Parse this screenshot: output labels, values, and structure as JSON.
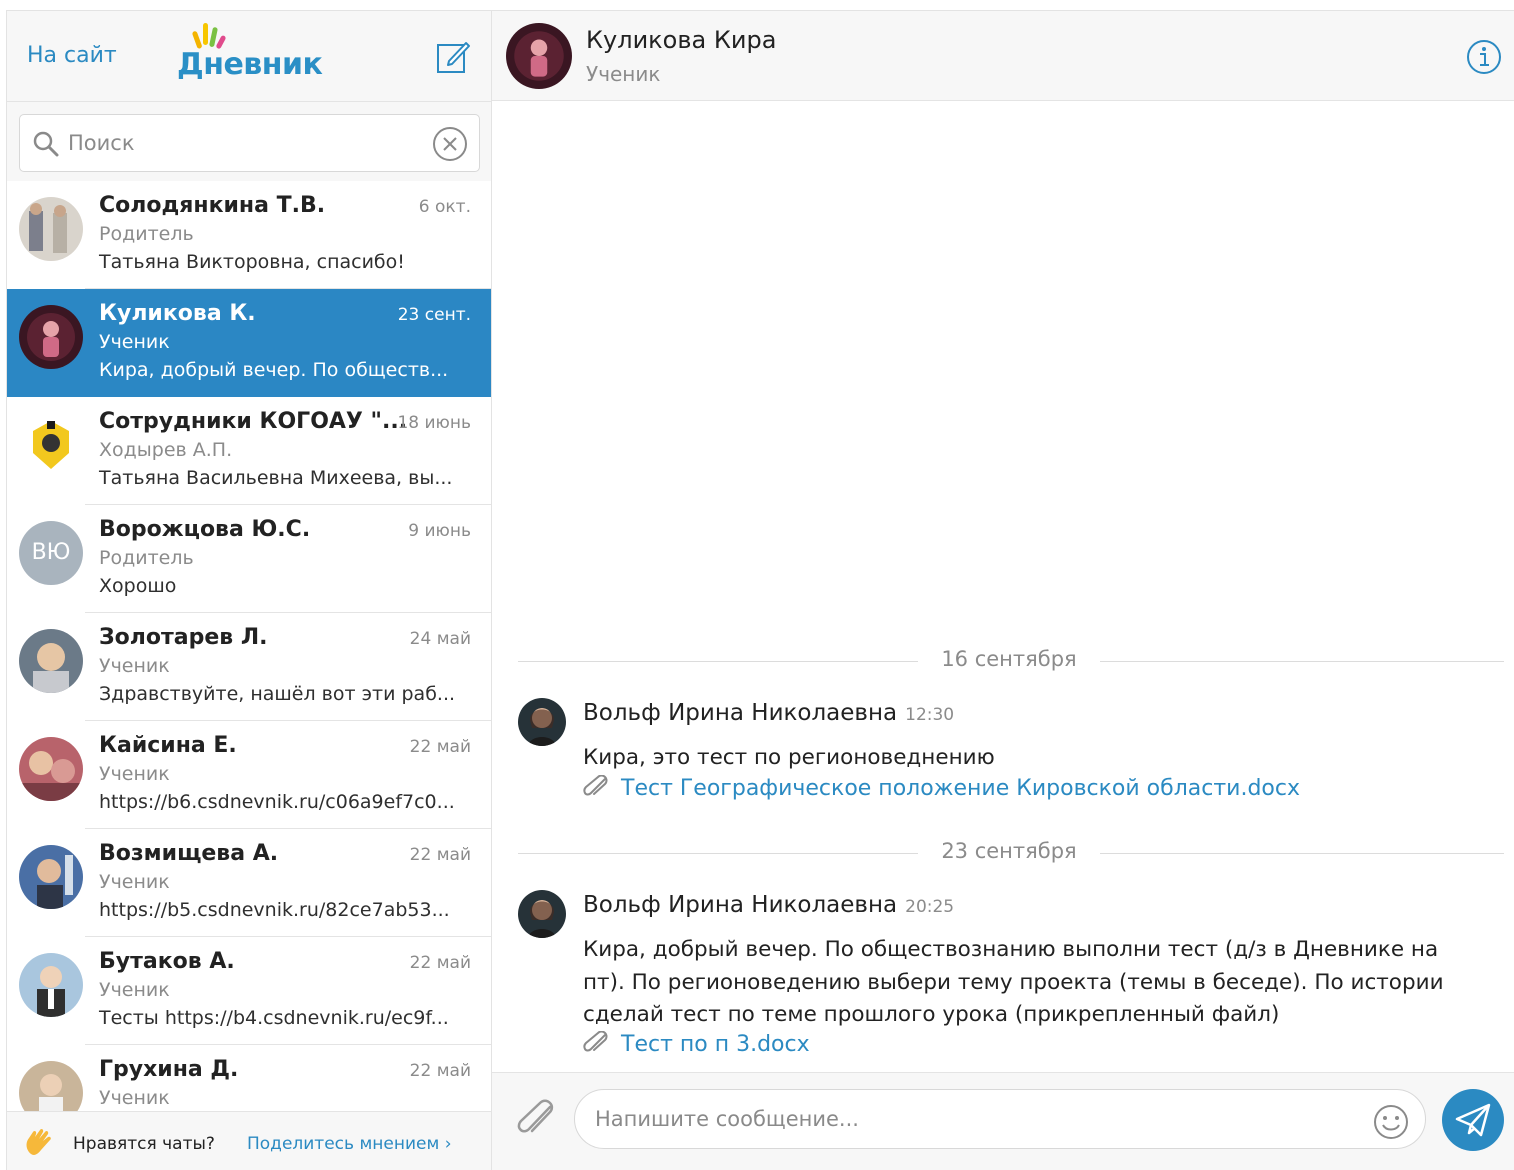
{
  "colors": {
    "accent": "#2b8ac2",
    "active_row": "#2b87c4",
    "muted": "#8b8b8b"
  },
  "sidebar": {
    "to_site_label": "На сайт",
    "logo_text": "Дневник",
    "search_placeholder": "Поиск",
    "chats": [
      {
        "name": "Солодянкина Т.В.",
        "date": "6 окт.",
        "role": "Родитель",
        "preview": "Татьяна Викторовна, спасибо!",
        "avatar": "photo"
      },
      {
        "name": "Куликова К.",
        "date": "23 сент.",
        "role": "Ученик",
        "preview": "Кира, добрый вечер. По обществ...",
        "avatar": "photo",
        "active": true
      },
      {
        "name": "Сотрудники КОГОАУ \"...",
        "date": "18 июнь",
        "role": "Ходырев А.П.",
        "preview": "Татьяна Васильевна Михеева, вы...",
        "avatar": "emblem"
      },
      {
        "name": "Ворожцова Ю.С.",
        "date": "9 июнь",
        "role": "Родитель",
        "preview": "Хорошо",
        "avatar": "initials",
        "initials": "ВЮ"
      },
      {
        "name": "Золотарев Л.",
        "date": "24 май",
        "role": "Ученик",
        "preview": "Здравствуйте, нашёл вот эти раб...",
        "avatar": "photo"
      },
      {
        "name": "Кайсина Е.",
        "date": "22 май",
        "role": "Ученик",
        "preview": "https://b6.csdnevnik.ru/c06a9ef7c0...",
        "avatar": "photo"
      },
      {
        "name": "Возмищева А.",
        "date": "22 май",
        "role": "Ученик",
        "preview": "https://b5.csdnevnik.ru/82ce7ab53...",
        "avatar": "photo"
      },
      {
        "name": "Бутаков А.",
        "date": "22 май",
        "role": "Ученик",
        "preview": "Тесты https://b4.csdnevnik.ru/ec9f...",
        "avatar": "photo"
      },
      {
        "name": "Грухина Д.",
        "date": "22 май",
        "role": "Ученик",
        "preview": "",
        "avatar": "photo"
      }
    ],
    "feedback": {
      "question": "Нравятся чаты?",
      "link": "Поделитесь мнением ›"
    }
  },
  "conversation": {
    "name": "Куликова Кира",
    "role": "Ученик",
    "days": [
      {
        "label": "16 сентября",
        "messages": [
          {
            "author": "Вольф Ирина Николаевна",
            "time": "12:30",
            "text": "Кира, это тест по регионоведнению",
            "attachment": "Тест Географическое положение Кировской области.docx"
          }
        ]
      },
      {
        "label": "23 сентября",
        "messages": [
          {
            "author": "Вольф Ирина Николаевна",
            "time": "20:25",
            "text": "Кира, добрый вечер. По обществознанию выполни тест (д/з в Дневнике на пт). По регионоведению выбери тему проекта (темы в беседе). По истории сделай тест по теме прошлого урока (прикрепленный файл)",
            "attachment": "Тест по п 3.docx"
          }
        ]
      }
    ],
    "composer_placeholder": "Напишите сообщение..."
  },
  "icons": {
    "compose": "compose-icon",
    "search": "search-icon",
    "clear": "clear-icon",
    "info": "info-icon",
    "attach": "paperclip-icon",
    "emoji": "smiley-icon",
    "send": "paper-plane-icon",
    "feedback": "waving-hand-icon"
  }
}
